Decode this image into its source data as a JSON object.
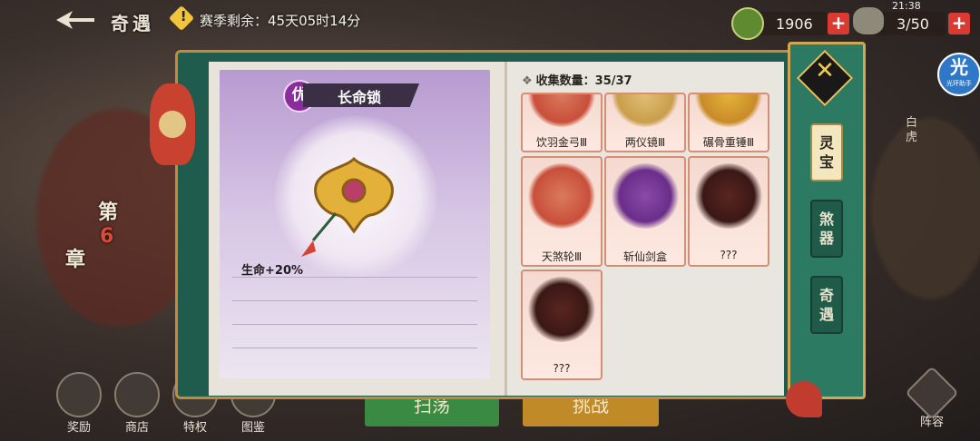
{
  "topbar": {
    "title": "奇遇",
    "warn_glyph": "!",
    "season_text": "赛季剩余：45天05时14分",
    "currency_value": "1906",
    "stamina_value": "3/50",
    "plus_label": "+",
    "clock": "21:38"
  },
  "assistant": {
    "big": "光",
    "small": "光环助手"
  },
  "left_panel": {
    "grade": "优",
    "item_name": "长命锁",
    "stat": "生命+20%"
  },
  "collection": {
    "label": "收集数量：35/37",
    "items": [
      {
        "label": "饮羽金弓Ⅲ"
      },
      {
        "label": "两仪镜Ⅲ"
      },
      {
        "label": "碾骨重锤Ⅲ"
      },
      {
        "label": "天煞轮Ⅲ"
      },
      {
        "label": "斩仙剑盒"
      },
      {
        "label": "???"
      },
      {
        "label": "???"
      }
    ]
  },
  "tabs": {
    "close": "✕",
    "items": [
      {
        "label": "灵\n宝",
        "active": true
      },
      {
        "label": "煞\n器",
        "active": false
      },
      {
        "label": "奇\n遇",
        "active": false
      }
    ]
  },
  "bottom": {
    "reward": "奖励",
    "shop": "商店",
    "privilege": "特权",
    "codex": "图鉴",
    "sweep": "扫荡",
    "challenge": "挑战",
    "lineup": "阵容"
  },
  "chapter": {
    "c1": "第",
    "c2": "6",
    "c3": "章"
  },
  "side_right_label": "白虎",
  "colors": {
    "accent_green": "#2c7a61",
    "gold": "#cfa755",
    "grade_purple": "#8a2d9c"
  }
}
